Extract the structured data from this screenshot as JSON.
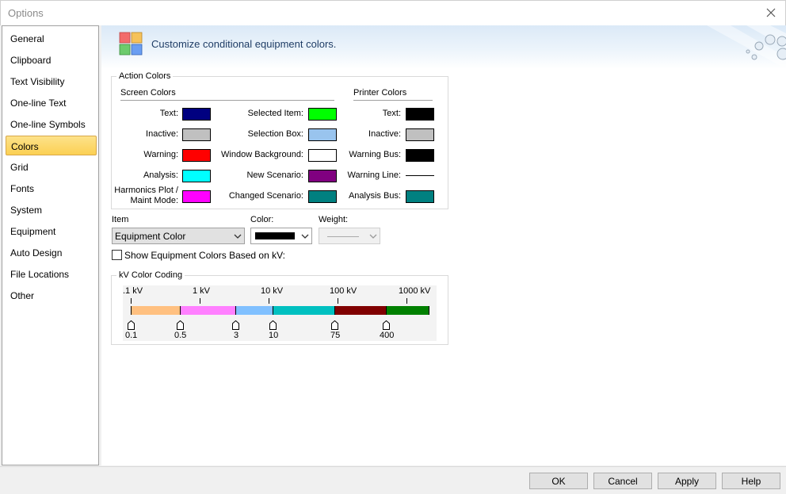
{
  "window": {
    "title": "Options"
  },
  "sidebar": {
    "items": [
      {
        "label": "General"
      },
      {
        "label": "Clipboard"
      },
      {
        "label": "Text Visibility"
      },
      {
        "label": "One-line Text"
      },
      {
        "label": "One-line Symbols"
      },
      {
        "label": "Colors",
        "selected": true
      },
      {
        "label": "Grid"
      },
      {
        "label": "Fonts"
      },
      {
        "label": "System"
      },
      {
        "label": "Equipment"
      },
      {
        "label": "Auto Design"
      },
      {
        "label": "File Locations"
      },
      {
        "label": "Other"
      }
    ]
  },
  "banner": {
    "text": "Customize conditional equipment colors."
  },
  "action_colors": {
    "legend": "Action Colors",
    "screen_header": "Screen Colors",
    "printer_header": "Printer Colors",
    "screen_col1": [
      {
        "label": "Text:",
        "color": "#000080"
      },
      {
        "label": "Inactive:",
        "color": "#c0c0c0"
      },
      {
        "label": "Warning:",
        "color": "#ff0000"
      },
      {
        "label": "Analysis:",
        "color": "#00ffff"
      },
      {
        "label_line1": "Harmonics Plot /",
        "label_line2": "Maint Mode:",
        "color": "#ff00ff"
      }
    ],
    "screen_col2": [
      {
        "label": "Selected Item:",
        "color": "#00ff00"
      },
      {
        "label": "Selection Box:",
        "color": "#99c4ee"
      },
      {
        "label": "Window Background:",
        "color": "#ffffff"
      },
      {
        "label": "New Scenario:",
        "color": "#800080"
      },
      {
        "label": "Changed Scenario:",
        "color": "#008080"
      }
    ],
    "printer_col": [
      {
        "label": "Text:",
        "color": "#000000"
      },
      {
        "label": "Inactive:",
        "color": "#c0c0c0"
      },
      {
        "label": "Warning Bus:",
        "color": "#000000"
      },
      {
        "label": "Warning Line:",
        "style": "line"
      },
      {
        "label": "Analysis Bus:",
        "color": "#008080"
      }
    ]
  },
  "item_row": {
    "item_label": "Item",
    "item_value": "Equipment Color",
    "color_label": "Color:",
    "color_value": "#000000",
    "weight_label": "Weight:"
  },
  "show_kv": {
    "label": "Show Equipment Colors Based on kV:",
    "checked": false
  },
  "kv_coding": {
    "legend": "kV Color Coding",
    "scale_labels": [
      ".1 kV",
      "1 kV",
      "10 kV",
      "100 kV",
      "1000 kV"
    ],
    "segments": [
      {
        "color": "#ffc080"
      },
      {
        "color": "#ff80ff"
      },
      {
        "color": "#80c0ff"
      },
      {
        "color": "#00c0c0"
      },
      {
        "color": "#800000"
      },
      {
        "color": "#008000"
      }
    ],
    "thresholds": [
      "0.1",
      "0.5",
      "3",
      "10",
      "75",
      "400"
    ]
  },
  "buttons": {
    "ok": "OK",
    "cancel": "Cancel",
    "apply": "Apply",
    "help": "Help"
  }
}
